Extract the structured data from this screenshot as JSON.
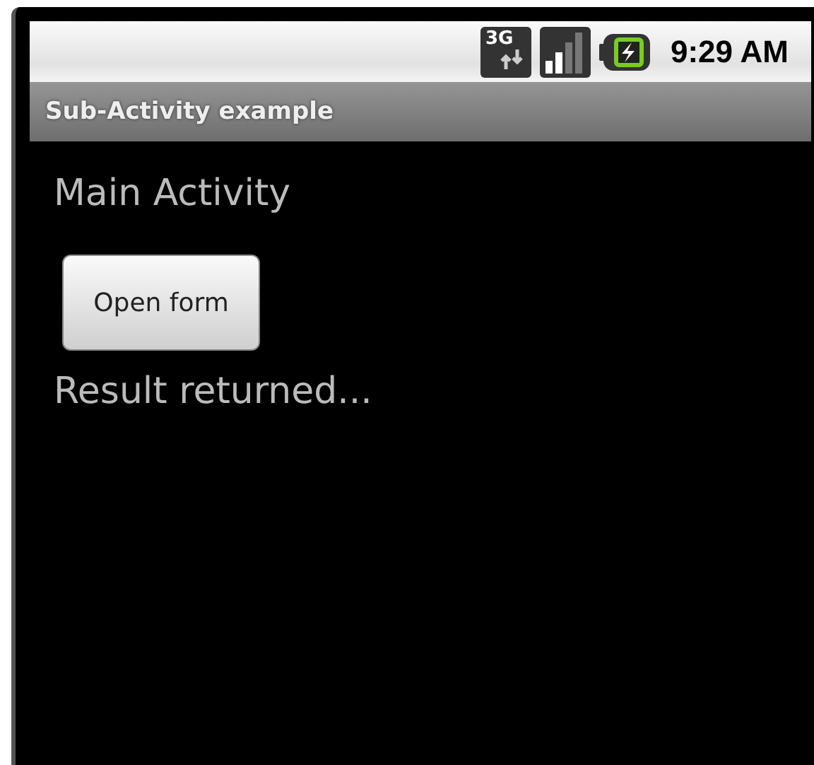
{
  "status_bar": {
    "network_type": "3G",
    "time": "9:29 AM"
  },
  "title_bar": {
    "title": "Sub-Activity example"
  },
  "content": {
    "heading": "Main Activity",
    "button": "Open form",
    "result": "Result returned..."
  }
}
